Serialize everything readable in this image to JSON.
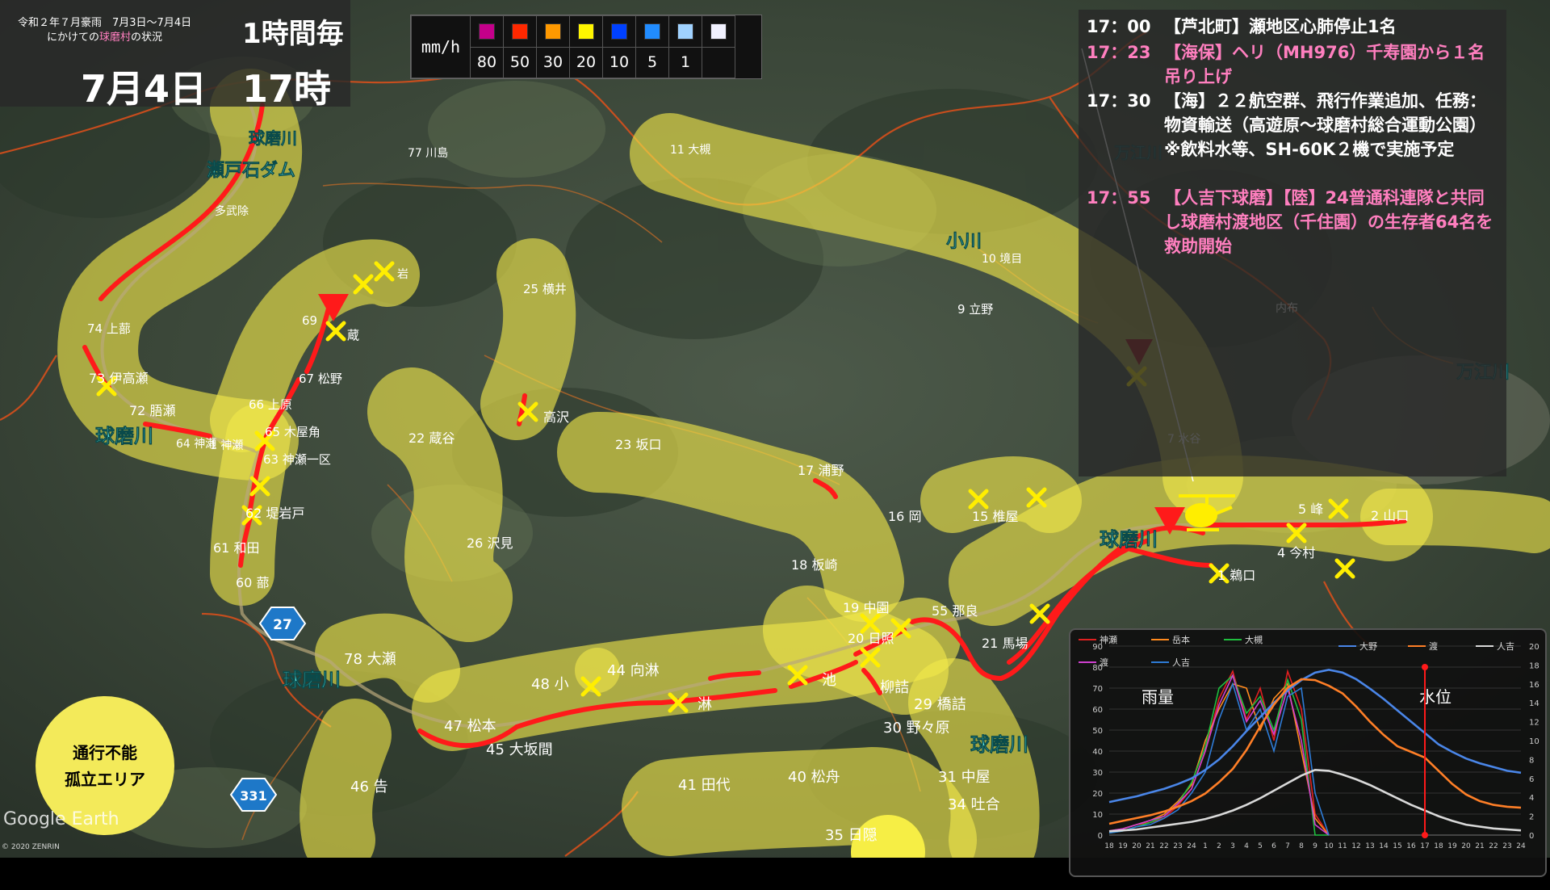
{
  "header": {
    "event_line1": "令和２年７月豪雨　7月3日～7月4日",
    "event_line2_a": "にかけての",
    "event_line2_b": "球磨村",
    "event_line2_c": "の状況",
    "interval": "1時間毎",
    "date": "7月4日",
    "hour": "17時"
  },
  "rain_legend": {
    "unit": "mm/h",
    "colors": [
      "#c4008a",
      "#ff2800",
      "#ff9900",
      "#fff500",
      "#0041ff",
      "#218cff",
      "#a0d2ff",
      "#f2f2ff"
    ],
    "values": [
      "80",
      "50",
      "30",
      "20",
      "10",
      "5",
      "1",
      ""
    ]
  },
  "log": [
    {
      "time": "17：00",
      "text": "【芦北町】瀬地区心肺停止1名",
      "color": "#ffffff"
    },
    {
      "time": "17：23",
      "text": "【海保】ヘリ（MH976）千寿園から１名吊り上げ",
      "color": "#ff7fbf"
    },
    {
      "time": "17：30",
      "text": "【海】２２航空群、飛行作業追加、任務：物資輸送（高遊原～球磨村総合運動公園）※飲料水等、SH-60K２機で実施予定",
      "color": "#ffffff"
    },
    {
      "time": "17：55",
      "text": "【人吉下球磨】【陸】24普通科連隊と共同し球磨村渡地区（千住園）の生存者64名を救助開始",
      "color": "#ff7fbf"
    }
  ],
  "legend": {
    "line1": "通行不能",
    "line2": "孤立エリア"
  },
  "watermarks": {
    "google": "Google Earth",
    "zenrin": "© 2020 ZENRIN"
  },
  "route_shields": [
    "27",
    "331"
  ],
  "map_labels": [
    {
      "text": "球磨川",
      "kind": "river"
    },
    {
      "text": "瀬戸石ダム",
      "kind": "river"
    },
    {
      "text": "球磨川",
      "kind": "river"
    },
    {
      "text": "球磨川",
      "kind": "river"
    },
    {
      "text": "球磨川",
      "kind": "river"
    },
    {
      "text": "球磨川",
      "kind": "river"
    },
    {
      "text": "小川",
      "kind": "river"
    },
    {
      "text": "万江川",
      "kind": "river"
    },
    {
      "text": "万江川",
      "kind": "river"
    },
    {
      "text": "77 川島",
      "kind": "place"
    },
    {
      "text": "11 大槻",
      "kind": "place"
    },
    {
      "text": "多武除",
      "kind": "place"
    },
    {
      "text": "74 上蔀",
      "kind": "place"
    },
    {
      "text": "73 伊高瀬",
      "kind": "place"
    },
    {
      "text": "72 䏸瀬",
      "kind": "place"
    },
    {
      "text": "64 神瀬",
      "kind": "place"
    },
    {
      "text": "69 ",
      "kind": "place"
    },
    {
      "text": "67 松野",
      "kind": "place"
    },
    {
      "text": "66 上原",
      "kind": "place"
    },
    {
      "text": "65 木屋角",
      "kind": "place"
    },
    {
      "text": "63 神瀬一区",
      "kind": "place"
    },
    {
      "text": "62 堤岩戸",
      "kind": "place"
    },
    {
      "text": "61 和田",
      "kind": "place"
    },
    {
      "text": "60 蔀",
      "kind": "place"
    },
    {
      "text": "25 横井",
      "kind": "place"
    },
    {
      "text": "22 蔵谷",
      "kind": "place"
    },
    {
      "text": "高沢",
      "kind": "place"
    },
    {
      "text": "26 沢見",
      "kind": "place"
    },
    {
      "text": "23 坂口",
      "kind": "place"
    },
    {
      "text": "17 浦野",
      "kind": "place"
    },
    {
      "text": "10 境目",
      "kind": "place"
    },
    {
      "text": "9 立野",
      "kind": "place"
    },
    {
      "text": "内布",
      "kind": "place"
    },
    {
      "text": "16 岡",
      "kind": "place"
    },
    {
      "text": "15 椎屋",
      "kind": "place"
    },
    {
      "text": "18 板崎",
      "kind": "place"
    },
    {
      "text": "19 中園",
      "kind": "place"
    },
    {
      "text": "20 日照",
      "kind": "place"
    },
    {
      "text": "55 那良",
      "kind": "place"
    },
    {
      "text": "21 馬場",
      "kind": "place"
    },
    {
      "text": "5 峰",
      "kind": "place"
    },
    {
      "text": "2 山口",
      "kind": "place"
    },
    {
      "text": "4 今村",
      "kind": "place"
    },
    {
      "text": "1 鵜口",
      "kind": "place"
    },
    {
      "text": "78 大瀬",
      "kind": "place"
    },
    {
      "text": "48 小",
      "kind": "place"
    },
    {
      "text": "44 向淋",
      "kind": "place"
    },
    {
      "text": "淋",
      "kind": "place"
    },
    {
      "text": "池",
      "kind": "place"
    },
    {
      "text": "柳詰",
      "kind": "place"
    },
    {
      "text": "29 橋詰",
      "kind": "place"
    },
    {
      "text": "30 野々原",
      "kind": "place"
    },
    {
      "text": "47 松本",
      "kind": "place"
    },
    {
      "text": "45 大坂間",
      "kind": "place"
    },
    {
      "text": "46 告",
      "kind": "place"
    },
    {
      "text": "41 田代",
      "kind": "place"
    },
    {
      "text": "40 松舟",
      "kind": "place"
    },
    {
      "text": "31 中屋",
      "kind": "place"
    },
    {
      "text": "34 吐合",
      "kind": "place"
    },
    {
      "text": "35 日隠",
      "kind": "place"
    },
    {
      "text": "7 水谷",
      "kind": "place"
    },
    {
      "text": "岩",
      "kind": "place"
    },
    {
      "text": "蔵",
      "kind": "place"
    },
    {
      "text": "1 神瀬",
      "kind": "place"
    }
  ],
  "chart_data": {
    "type": "line",
    "categories": [
      "18",
      "19",
      "20",
      "21",
      "22",
      "23",
      "24",
      "1",
      "2",
      "3",
      "4",
      "5",
      "6",
      "7",
      "8",
      "9",
      "10",
      "11",
      "12",
      "13",
      "14",
      "15",
      "16",
      "17",
      "18",
      "19",
      "20",
      "21",
      "22",
      "23",
      "24"
    ],
    "ylim_left": [
      0,
      90
    ],
    "ylim_right": [
      0,
      20
    ],
    "left_ticks": [
      "0",
      "10",
      "20",
      "30",
      "40",
      "50",
      "60",
      "70",
      "80",
      "90"
    ],
    "right_ticks": [
      "0",
      "2",
      "4",
      "6",
      "8",
      "10",
      "12",
      "14",
      "16",
      "18",
      "20"
    ],
    "left_label": "雨量",
    "right_label": "水位",
    "marker_category": "17",
    "marker_color": "#ff1a1a",
    "series": [
      {
        "name": "神瀬",
        "axis": "left",
        "color": "#e02020",
        "values": [
          2,
          3,
          5,
          6,
          8,
          14,
          22,
          40,
          65,
          78,
          55,
          70,
          45,
          78,
          60,
          10,
          0
        ]
      },
      {
        "name": "岳本",
        "axis": "left",
        "color": "#ff8a1e",
        "values": [
          1,
          3,
          5,
          7,
          10,
          16,
          24,
          45,
          60,
          72,
          70,
          50,
          65,
          72,
          40,
          8,
          0
        ]
      },
      {
        "name": "大槻",
        "axis": "left",
        "color": "#1fbf3f",
        "values": [
          1,
          2,
          4,
          6,
          9,
          15,
          25,
          42,
          70,
          76,
          58,
          66,
          50,
          74,
          55,
          0,
          0
        ]
      },
      {
        "name": "渡",
        "axis": "left",
        "color": "#d040d0",
        "values": [
          2,
          3,
          5,
          7,
          9,
          15,
          22,
          40,
          62,
          76,
          54,
          64,
          48,
          70,
          45,
          5,
          0
        ]
      },
      {
        "name": "人吉",
        "axis": "left",
        "color": "#2e7bd6",
        "values": [
          1,
          2,
          4,
          5,
          8,
          12,
          20,
          30,
          55,
          72,
          50,
          60,
          40,
          66,
          70,
          20,
          0
        ]
      },
      {
        "name": "大野",
        "axis": "right",
        "color": "#4a86e8",
        "values": [
          3.5,
          3.8,
          4.1,
          4.5,
          4.9,
          5.4,
          6.0,
          6.9,
          8.0,
          9.4,
          11.0,
          12.5,
          14.0,
          15.3,
          16.4,
          17.2,
          17.5,
          17.2,
          16.5,
          15.5,
          14.4,
          13.2,
          12.0,
          10.8,
          9.6,
          8.8,
          8.1,
          7.6,
          7.2,
          6.8,
          6.6
        ]
      },
      {
        "name": "渡",
        "axis": "right",
        "color": "#ff7f27",
        "values": [
          1.2,
          1.5,
          1.8,
          2.1,
          2.5,
          3.0,
          3.6,
          4.4,
          5.6,
          7.0,
          9.0,
          11.5,
          13.8,
          15.6,
          16.5,
          16.4,
          15.8,
          15.0,
          13.6,
          12.0,
          10.6,
          9.4,
          8.8,
          8.2,
          6.8,
          5.4,
          4.3,
          3.6,
          3.2,
          3.0,
          2.9
        ]
      },
      {
        "name": "人吉",
        "axis": "right",
        "color": "#d9d9d9",
        "values": [
          0.4,
          0.5,
          0.6,
          0.8,
          1.0,
          1.2,
          1.4,
          1.7,
          2.1,
          2.6,
          3.2,
          3.9,
          4.7,
          5.5,
          6.3,
          6.9,
          6.8,
          6.4,
          5.9,
          5.3,
          4.6,
          3.9,
          3.2,
          2.6,
          2.0,
          1.5,
          1.1,
          0.9,
          0.7,
          0.6,
          0.5
        ]
      }
    ]
  }
}
